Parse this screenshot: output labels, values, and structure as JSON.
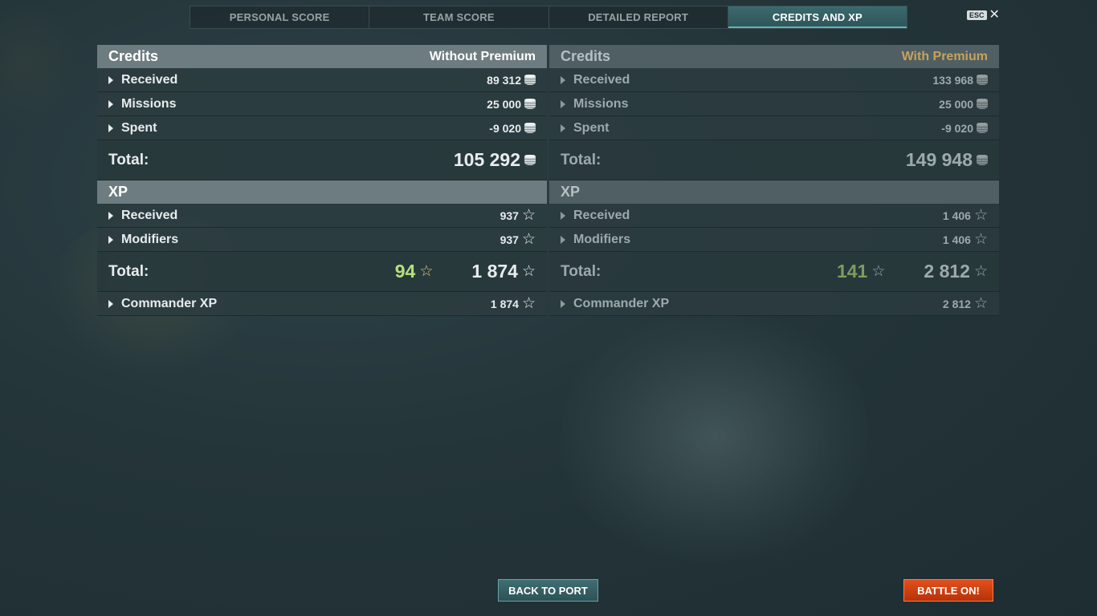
{
  "tabs": [
    {
      "label": "PERSONAL SCORE"
    },
    {
      "label": "TEAM SCORE"
    },
    {
      "label": "DETAILED REPORT"
    },
    {
      "label": "CREDITS AND XP",
      "active": true
    }
  ],
  "esc": {
    "key": "ESC",
    "close": "✕"
  },
  "left": {
    "credits": {
      "title": "Credits",
      "subtitle": "Without Premium",
      "rows": [
        {
          "label": "Received",
          "value": "89 312"
        },
        {
          "label": "Missions",
          "value": "25 000"
        },
        {
          "label": "Spent",
          "value": "-9 020"
        }
      ],
      "total_label": "Total:",
      "total_value": "105 292"
    },
    "xp": {
      "title": "XP",
      "rows": [
        {
          "label": "Received",
          "value": "937"
        },
        {
          "label": "Modifiers",
          "value": "937"
        }
      ],
      "total_label": "Total:",
      "bonus_value": "94",
      "total_value": "1 874",
      "commander_label": "Commander XP",
      "commander_value": "1 874"
    }
  },
  "right": {
    "credits": {
      "title": "Credits",
      "subtitle": "With Premium",
      "rows": [
        {
          "label": "Received",
          "value": "133 968"
        },
        {
          "label": "Missions",
          "value": "25 000"
        },
        {
          "label": "Spent",
          "value": "-9 020"
        }
      ],
      "total_label": "Total:",
      "total_value": "149 948"
    },
    "xp": {
      "title": "XP",
      "rows": [
        {
          "label": "Received",
          "value": "1 406"
        },
        {
          "label": "Modifiers",
          "value": "1 406"
        }
      ],
      "total_label": "Total:",
      "bonus_value": "141",
      "total_value": "2 812",
      "commander_label": "Commander XP",
      "commander_value": "2 812"
    }
  },
  "icons": {
    "credits": "silver-coin-icon",
    "xp": "star-icon",
    "expand": "triangle-right-icon"
  },
  "colors": {
    "premium_accent": "#c7a25a",
    "bonus_green": "#b8e07a",
    "battle_button": "#d2451a",
    "active_tab": "#3a6a6e"
  },
  "buttons": {
    "back_to_port": "BACK TO PORT",
    "battle_on": "BATTLE ON!"
  }
}
